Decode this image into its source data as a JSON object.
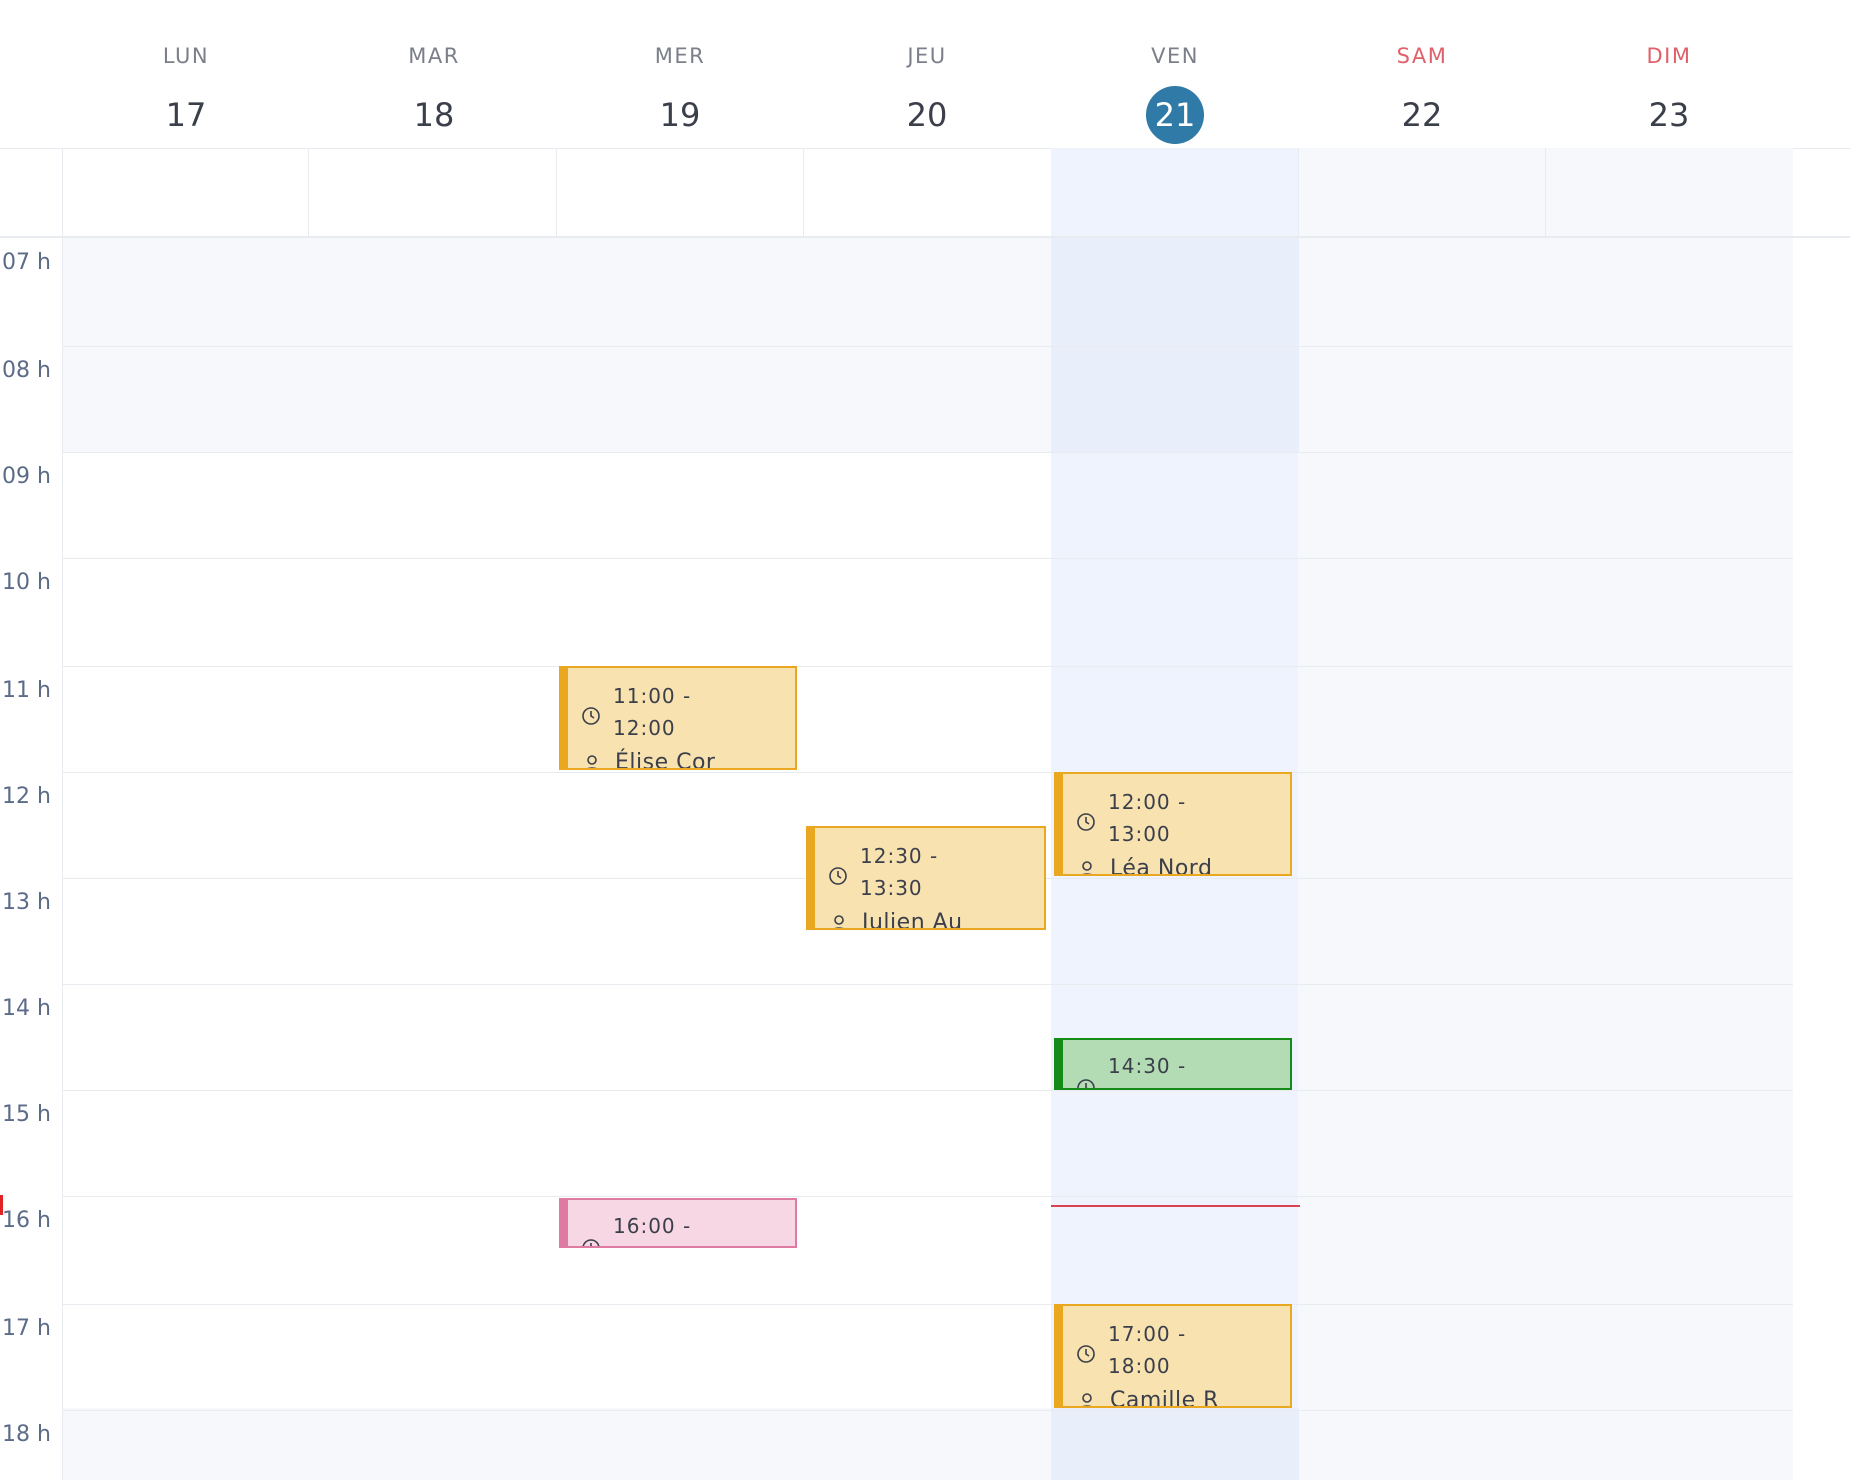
{
  "week": {
    "days": [
      {
        "name": "LUN",
        "num": "17"
      },
      {
        "name": "MAR",
        "num": "18"
      },
      {
        "name": "MER",
        "num": "19"
      },
      {
        "name": "JEU",
        "num": "20"
      },
      {
        "name": "VEN",
        "num": "21"
      },
      {
        "name": "SAM",
        "num": "22"
      },
      {
        "name": "DIM",
        "num": "23"
      }
    ],
    "today_index": 4,
    "weekend_color": "#e0606a",
    "today_color": "#2f7aa6"
  },
  "hours": [
    "07 h",
    "08 h",
    "09 h",
    "10 h",
    "11 h",
    "12 h",
    "13 h",
    "14 h",
    "15 h",
    "16 h",
    "17 h",
    "18 h"
  ],
  "events": [
    {
      "day": "MER",
      "time_start": "11:00 -",
      "time_end": "12:00",
      "person": "Élise Cor",
      "color": "yellow"
    },
    {
      "day": "JEU",
      "time_start": "12:30 -",
      "time_end": "13:30",
      "person": "Julien Au",
      "color": "yellow"
    },
    {
      "day": "VEN",
      "time_start": "12:00 -",
      "time_end": "13:00",
      "person": "Léa Nord",
      "color": "yellow"
    },
    {
      "day": "VEN",
      "time_start": "14:30 -",
      "color": "green"
    },
    {
      "day": "MER",
      "time_start": "16:00 -",
      "color": "pink"
    },
    {
      "day": "VEN",
      "time_start": "17:00 -",
      "time_end": "18:00",
      "person": "Camille R",
      "color": "yellow"
    }
  ]
}
